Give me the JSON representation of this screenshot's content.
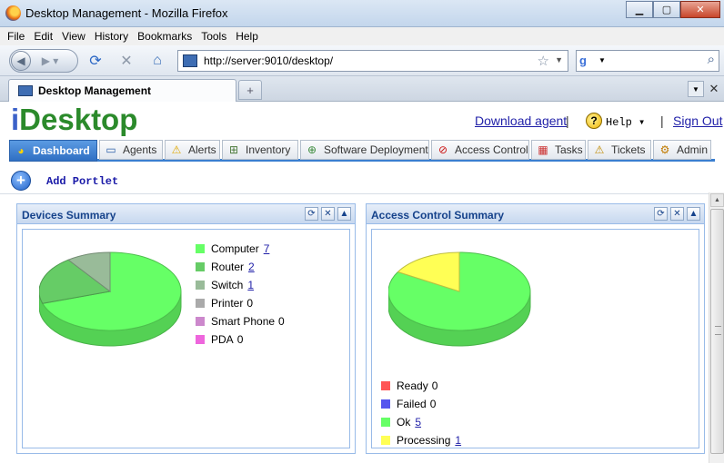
{
  "window": {
    "title": "Desktop Management - Mozilla Firefox",
    "min_label": "▁",
    "max_label": "▢",
    "close_label": "✕"
  },
  "menu": [
    "File",
    "Edit",
    "View",
    "History",
    "Bookmarks",
    "Tools",
    "Help"
  ],
  "nav": {
    "url": "http://server:9010/desktop/",
    "search_placeholder": ""
  },
  "browser_tab": {
    "title": "Desktop Management",
    "new_tab_label": "+"
  },
  "app": {
    "logo_i": "i",
    "logo_rest": "Desktop",
    "download_agent": "Download agent",
    "separator": "|",
    "help": "Help",
    "sign_out": "Sign Out",
    "tabs": [
      {
        "label": "Dashboard",
        "icon": "dashboard-icon",
        "active": true
      },
      {
        "label": "Agents",
        "icon": "monitor-icon",
        "active": false
      },
      {
        "label": "Alerts",
        "icon": "warning-icon",
        "active": false
      },
      {
        "label": "Inventory",
        "icon": "inventory-icon",
        "active": false
      },
      {
        "label": "Software Deployment",
        "icon": "deploy-icon",
        "active": false
      },
      {
        "label": "Access Control",
        "icon": "no-entry-icon",
        "active": false
      },
      {
        "label": "Tasks",
        "icon": "calendar-icon",
        "active": false
      },
      {
        "label": "Tickets",
        "icon": "ticket-icon",
        "active": false
      },
      {
        "label": "Admin",
        "icon": "gear-icon",
        "active": false
      }
    ],
    "add_portlet": "Add Portlet"
  },
  "portlets": {
    "devices": {
      "title": "Devices Summary",
      "legend": [
        {
          "label": "Computer",
          "value": "7",
          "link": true,
          "color": "#66ff66"
        },
        {
          "label": "Router",
          "value": "2",
          "link": true,
          "color": "#66cc66"
        },
        {
          "label": "Switch",
          "value": "1",
          "link": true,
          "color": "#99bb99"
        },
        {
          "label": "Printer",
          "value": "0",
          "link": false,
          "color": "#aaaaaa"
        },
        {
          "label": "Smart Phone",
          "value": "0",
          "link": false,
          "color": "#cc88cc"
        },
        {
          "label": "PDA",
          "value": "0",
          "link": false,
          "color": "#ee66dd"
        }
      ]
    },
    "access": {
      "title": "Access Control Summary",
      "legend": [
        {
          "label": "Ready",
          "value": "0",
          "link": false,
          "color": "#ff5555"
        },
        {
          "label": "Failed",
          "value": "0",
          "link": false,
          "color": "#5555ee"
        },
        {
          "label": "Ok",
          "value": "5",
          "link": true,
          "color": "#66ff66"
        },
        {
          "label": "Processing",
          "value": "1",
          "link": true,
          "color": "#ffff55"
        }
      ]
    }
  },
  "chart_data": [
    {
      "type": "pie",
      "categories": [
        "Computer",
        "Router",
        "Switch",
        "Printer",
        "Smart Phone",
        "PDA"
      ],
      "values": [
        7,
        2,
        1,
        0,
        0,
        0
      ]
    },
    {
      "type": "pie",
      "categories": [
        "Ready",
        "Failed",
        "Ok",
        "Processing"
      ],
      "values": [
        0,
        0,
        5,
        1
      ]
    }
  ]
}
